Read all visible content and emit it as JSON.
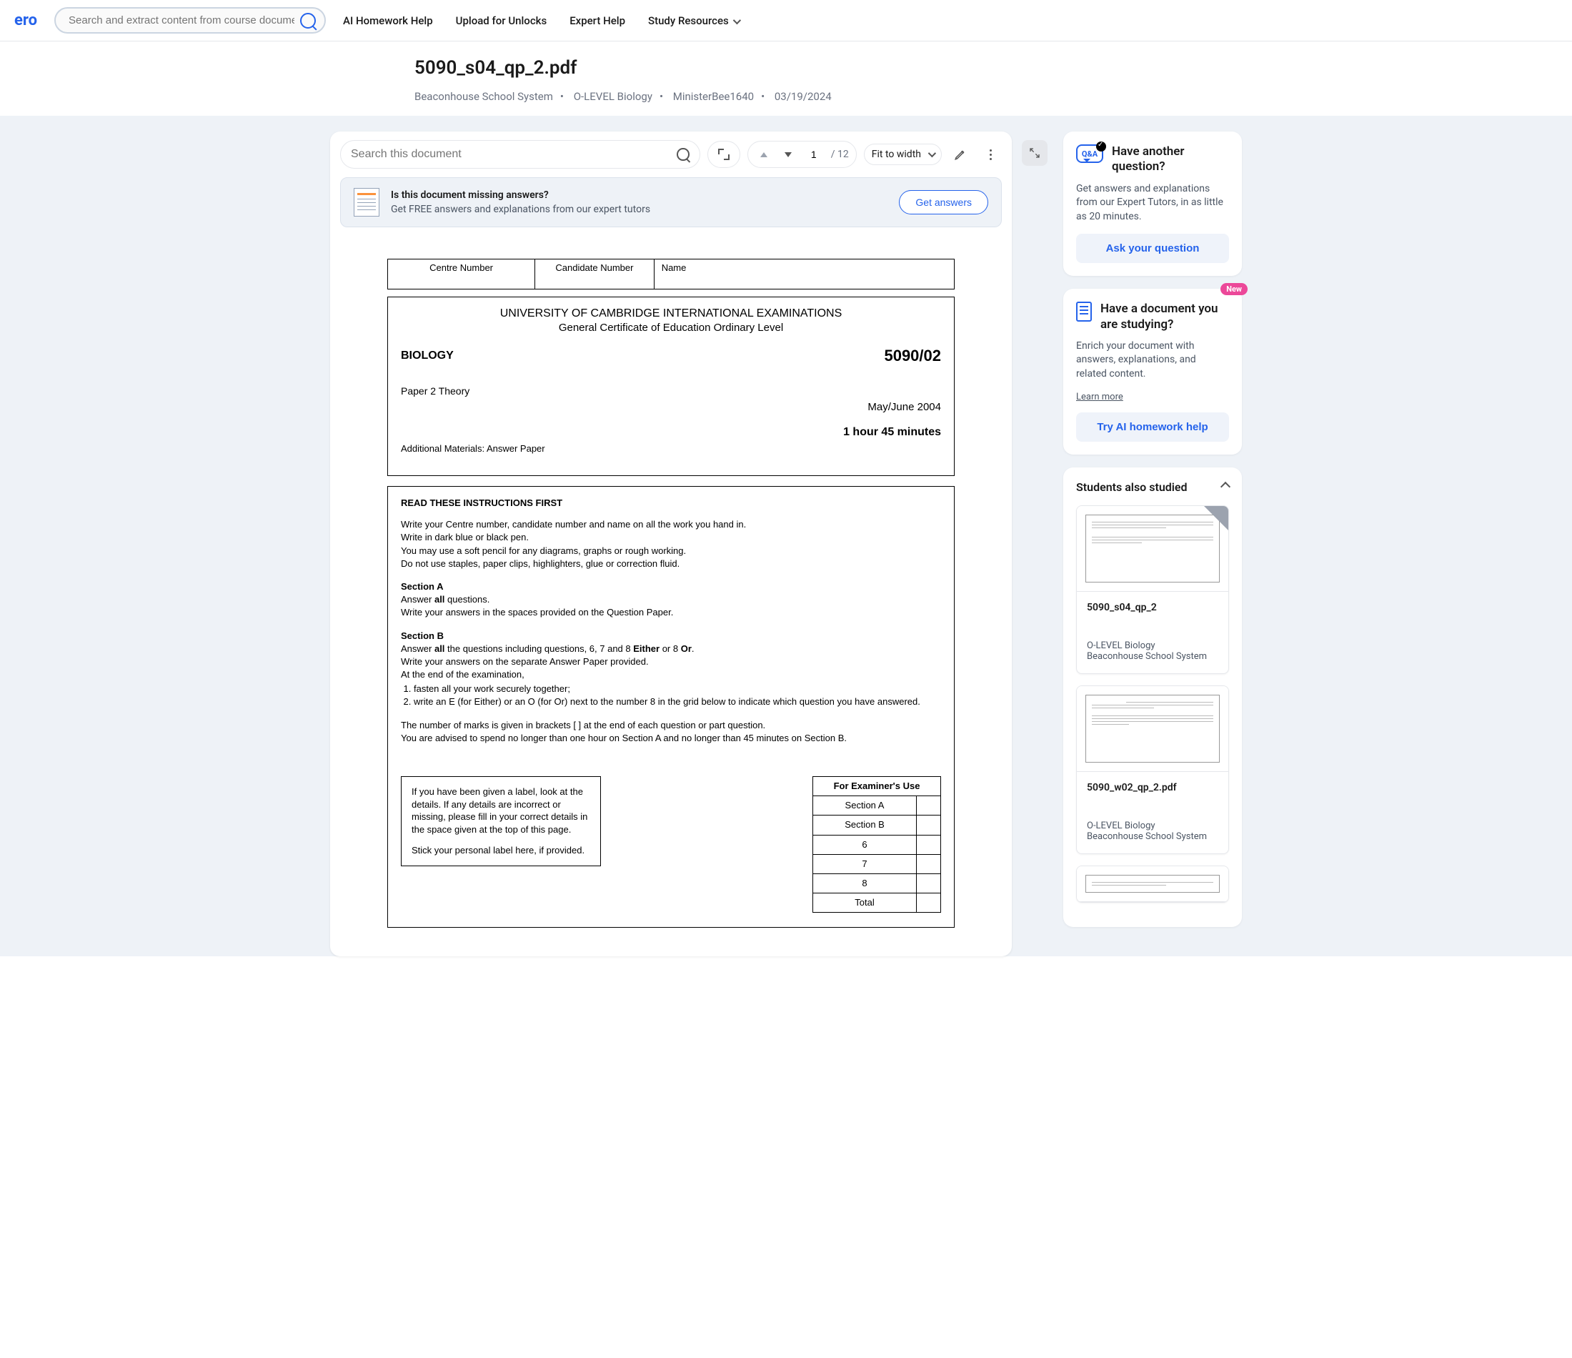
{
  "header": {
    "logo_text": "ero",
    "search_placeholder": "Search and extract content from course documents,",
    "nav": {
      "ai_help": "AI Homework Help",
      "upload": "Upload for Unlocks",
      "expert": "Expert Help",
      "resources": "Study Resources"
    }
  },
  "title": {
    "doc_name": "5090_s04_qp_2.pdf",
    "school": "Beaconhouse School System",
    "course": "O-LEVEL Biology",
    "uploader": "MinisterBee1640",
    "date": "03/19/2024"
  },
  "viewer": {
    "search_placeholder": "Search this document",
    "page_current": "1",
    "page_total": "/ 12",
    "fit": "Fit to width"
  },
  "banner": {
    "title": "Is this document missing answers?",
    "subtitle": "Get FREE answers and explanations from our expert tutors",
    "button": "Get answers"
  },
  "doc": {
    "centre": "Centre Number",
    "candidate": "Candidate Number",
    "name": "Name",
    "uni": "UNIVERSITY OF CAMBRIDGE INTERNATIONAL EXAMINATIONS",
    "gce": "General Certificate of Education Ordinary Level",
    "subject": "BIOLOGY",
    "code": "5090/02",
    "paper": "Paper 2  Theory",
    "exam_date": "May/June 2004",
    "duration": "1 hour 45 minutes",
    "materials": "Additional Materials:    Answer Paper",
    "instr_title": "READ THESE INSTRUCTIONS FIRST",
    "instr1": "Write your Centre number, candidate number and name on all the work you hand in.",
    "instr2": "Write in dark blue or black pen.",
    "instr3": "You may use a soft pencil for any diagrams, graphs or rough working.",
    "instr4": "Do not use staples, paper clips, highlighters, glue or correction fluid.",
    "secA": "Section A",
    "secA_1a": "Answer ",
    "secA_1b": "all",
    "secA_1c": " questions.",
    "secA_2": "Write your answers in the spaces provided on the Question Paper.",
    "secB": "Section B",
    "secB_1a": "Answer ",
    "secB_1b": "all",
    "secB_1c": " the questions including questions, 6, 7 and 8 ",
    "secB_1d": "Either",
    "secB_1e": " or 8 ",
    "secB_1f": "Or",
    "secB_1g": ".",
    "secB_2": "Write your answers on the separate Answer Paper provided.",
    "secB_3": "At the end of the examination,",
    "secB_li1": "fasten all your work securely together;",
    "secB_li2": "write an E (for Either) or an O (for Or) next to the number 8 in the grid below to indicate which question you have answered.",
    "marks": "The number of marks is given in brackets [  ] at the end of each question or part question.",
    "advice": "You are advised to spend no longer than one hour on Section A and no longer than 45 minutes on Section B.",
    "label1": "If you have been given a label, look at the details. If any details are incorrect or missing, please fill in your correct details in the space given at the top of this page.",
    "label2": "Stick your personal label here, if provided.",
    "exam_use_title": "For Examiner's Use",
    "exam_use_rows": [
      "Section A",
      "Section B",
      "6",
      "7",
      "8",
      "Total"
    ]
  },
  "side_qa": {
    "title": "Have another question?",
    "desc": "Get answers and explanations from our Expert Tutors, in as little as 20 minutes.",
    "button": "Ask your question"
  },
  "side_ai": {
    "badge": "New",
    "title": "Have a document you are studying?",
    "desc": "Enrich your document with answers, explanations, and related content.",
    "learn": "Learn more",
    "button": "Try AI homework help"
  },
  "also": {
    "title": "Students also studied",
    "items": [
      {
        "name": "5090_s04_qp_2",
        "course": "O-LEVEL Biology",
        "school": "Beaconhouse School System"
      },
      {
        "name": "5090_w02_qp_2.pdf",
        "course": "O-LEVEL Biology",
        "school": "Beaconhouse School System"
      }
    ]
  }
}
